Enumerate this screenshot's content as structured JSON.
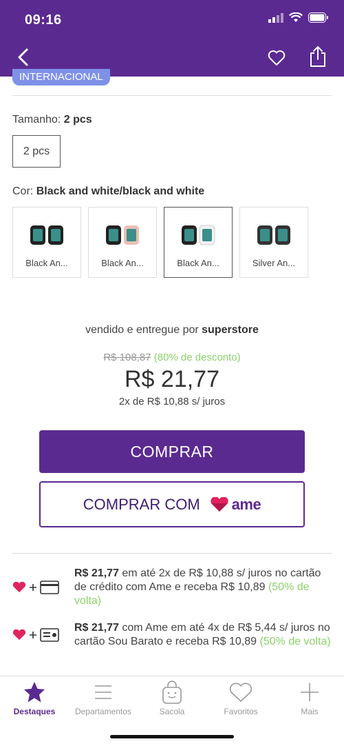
{
  "status": {
    "time": "09:16"
  },
  "header": {
    "back_icon": "chevron-left-icon",
    "favorite_icon": "heart-outline-icon",
    "share_icon": "share-icon"
  },
  "badge": {
    "label": "INTERNACIONAL"
  },
  "size": {
    "label": "Tamanho:",
    "value": "2 pcs",
    "options": [
      "2 pcs"
    ]
  },
  "color": {
    "label": "Cor:",
    "value": "Black and white/black and white",
    "swatches": [
      {
        "label": "Black An..."
      },
      {
        "label": "Black An..."
      },
      {
        "label": "Black An..."
      },
      {
        "label": "Silver An..."
      }
    ],
    "selected_index": 2
  },
  "seller": {
    "prefix": "vendido e entregue por",
    "name": "superstore"
  },
  "price": {
    "old": "R$ 108,87",
    "discount": "(80% de desconto)",
    "current": "R$ 21,77",
    "installments": "2x de R$ 10,88 s/ juros"
  },
  "buttons": {
    "buy": "COMPRAR",
    "buy_with": "COMPRAR COM",
    "ame_logo_text": "ame"
  },
  "offers": [
    {
      "price": "R$ 21,77",
      "text": "em até 2x de R$ 10,88 s/ juros no cartão de crédito  com Ame e receba R$ 10,89",
      "cashback": "(50% de volta)",
      "icon": "credit-card-icon"
    },
    {
      "price": "R$ 21,77",
      "text": "com Ame em até 4x de R$ 5,44 s/ juros no cartão Sou Barato  e receba R$ 10,89",
      "cashback": "(50% de volta)",
      "icon": "store-card-icon"
    }
  ],
  "tabs": [
    {
      "label": "Destaques",
      "icon": "star-icon",
      "active": true
    },
    {
      "label": "Departamentos",
      "icon": "menu-icon",
      "active": false
    },
    {
      "label": "Sacola",
      "icon": "bag-icon",
      "active": false
    },
    {
      "label": "Favoritos",
      "icon": "heart-icon",
      "active": false
    },
    {
      "label": "Mais",
      "icon": "plus-icon",
      "active": false
    }
  ],
  "colors": {
    "brand": "#5b2a91",
    "discount": "#8cd26b",
    "badge": "#7e91e8",
    "ame_heart": "#e0245e"
  }
}
